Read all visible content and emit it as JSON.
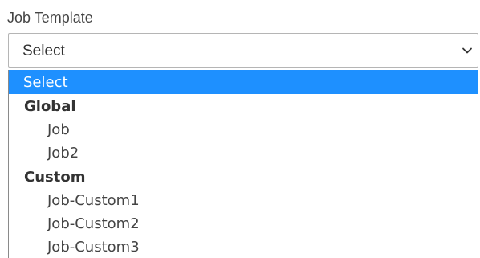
{
  "field": {
    "label": "Job Template",
    "selected_value": "Select"
  },
  "dropdown": {
    "placeholder_option": "Select",
    "groups": [
      {
        "label": "Global",
        "options": [
          "Job",
          "Job2"
        ]
      },
      {
        "label": "Custom",
        "options": [
          "Job-Custom1",
          "Job-Custom2",
          "Job-Custom3"
        ]
      }
    ]
  },
  "colors": {
    "highlight": "#1e90ff",
    "text": "#333333",
    "border": "#b5b5b5"
  },
  "icons": {
    "select_arrow": "chevron-down-icon"
  }
}
